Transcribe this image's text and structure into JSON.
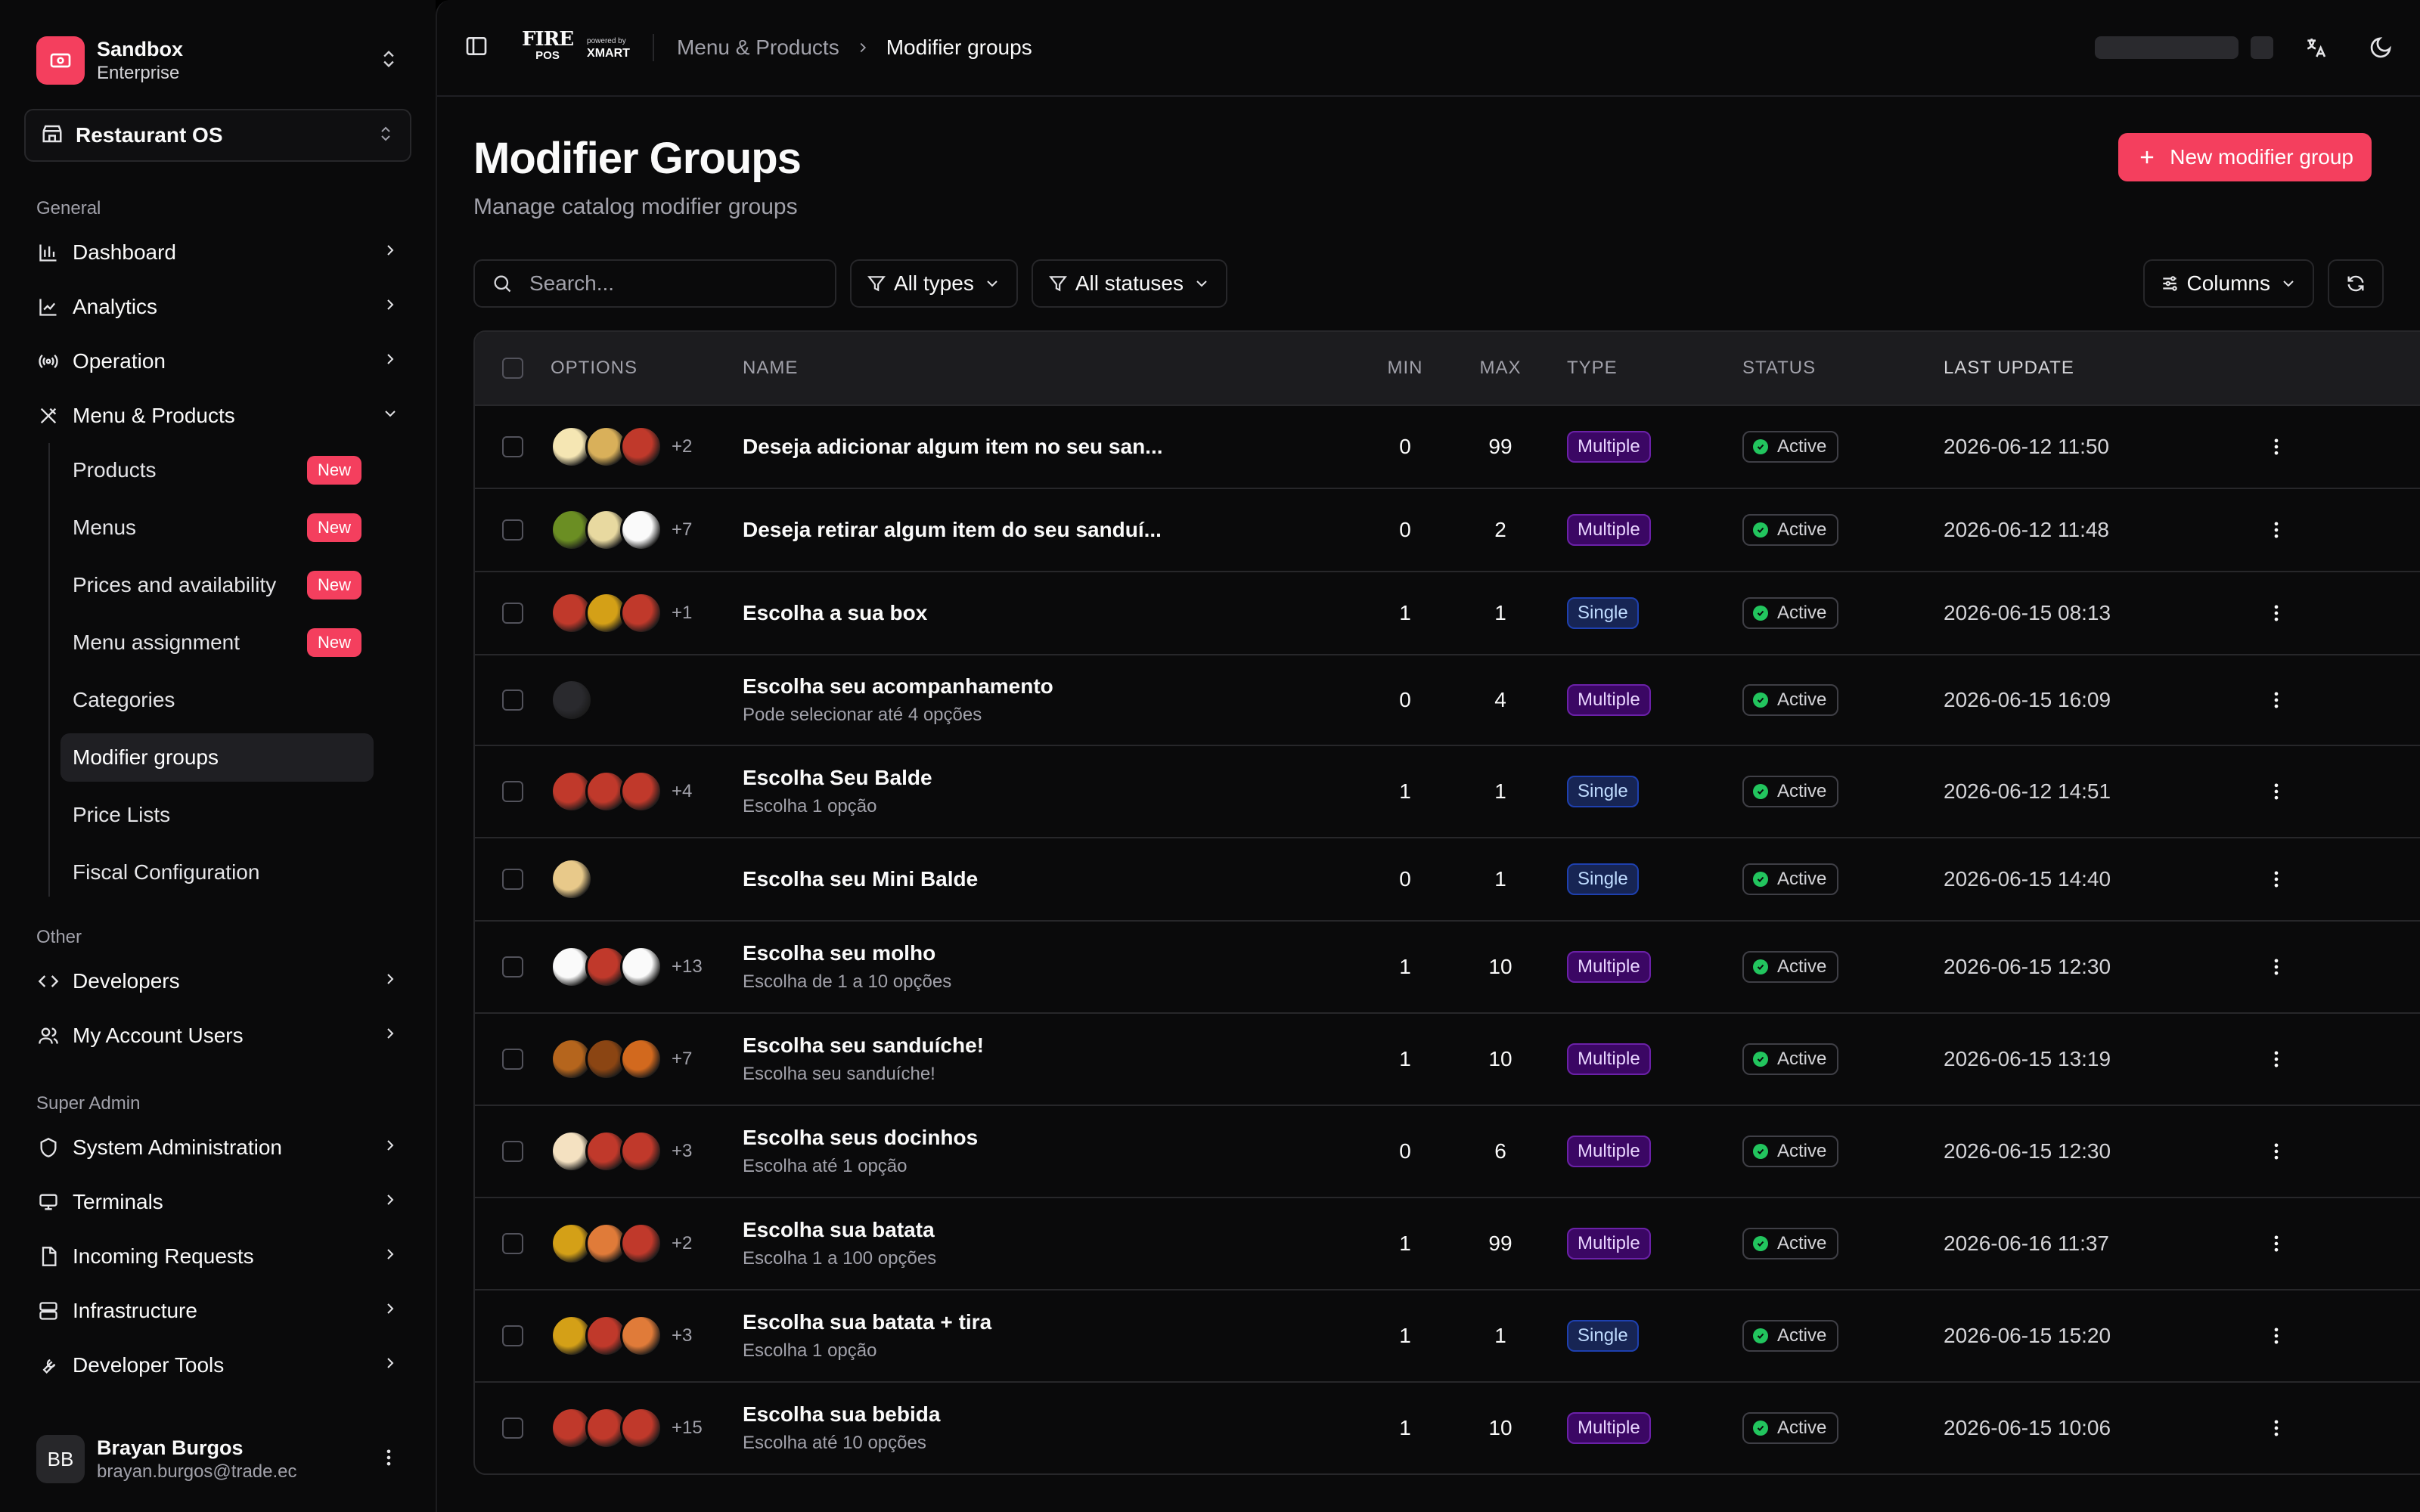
{
  "org": {
    "name": "Sandbox",
    "plan": "Enterprise"
  },
  "store": {
    "label": "Restaurant OS"
  },
  "sections": {
    "general": "General",
    "other": "Other",
    "super_admin": "Super Admin"
  },
  "nav": {
    "dashboard": "Dashboard",
    "analytics": "Analytics",
    "operation": "Operation",
    "menu_products": "Menu & Products",
    "developers": "Developers",
    "my_account_users": "My Account Users",
    "system_administration": "System Administration",
    "terminals": "Terminals",
    "incoming_requests": "Incoming Requests",
    "infrastructure": "Infrastructure",
    "developer_tools": "Developer Tools"
  },
  "sub_nav": [
    {
      "label": "Products",
      "badge": "New"
    },
    {
      "label": "Menus",
      "badge": "New"
    },
    {
      "label": "Prices and availability",
      "badge": "New"
    },
    {
      "label": "Menu assignment",
      "badge": "New"
    },
    {
      "label": "Categories",
      "badge": ""
    },
    {
      "label": "Modifier groups",
      "badge": ""
    },
    {
      "label": "Price Lists",
      "badge": ""
    },
    {
      "label": "Fiscal Configuration",
      "badge": ""
    }
  ],
  "user": {
    "initials": "BB",
    "name": "Brayan Burgos",
    "email": "brayan.burgos@trade.ec"
  },
  "brand": {
    "logo_main": "FIRE",
    "logo_sub": "POS",
    "powered": "powered by",
    "partner": "XMART"
  },
  "breadcrumb": {
    "parent": "Menu & Products",
    "current": "Modifier groups"
  },
  "page": {
    "title": "Modifier Groups",
    "subtitle": "Manage catalog modifier groups",
    "new_button": "New modifier group"
  },
  "toolbar": {
    "search_placeholder": "Search...",
    "type_filter": "All types",
    "status_filter": "All statuses",
    "columns": "Columns"
  },
  "table": {
    "headers": {
      "options": "OPTIONS",
      "name": "NAME",
      "min": "MIN",
      "max": "MAX",
      "type": "TYPE",
      "status": "STATUS",
      "last_update": "LAST UPDATE"
    },
    "rows": [
      {
        "more": "+2",
        "name": "Deseja adicionar algum item no seu san...",
        "desc": "",
        "min": "0",
        "max": "99",
        "type": "Multiple",
        "status": "Active",
        "updated": "2026-06-12 11:50"
      },
      {
        "more": "+7",
        "name": "Deseja retirar algum item do seu sanduí...",
        "desc": "",
        "min": "0",
        "max": "2",
        "type": "Multiple",
        "status": "Active",
        "updated": "2026-06-12 11:48"
      },
      {
        "more": "+1",
        "name": "Escolha a sua box",
        "desc": "",
        "min": "1",
        "max": "1",
        "type": "Single",
        "status": "Active",
        "updated": "2026-06-15 08:13"
      },
      {
        "more": "",
        "name": "Escolha seu acompanhamento",
        "desc": "Pode selecionar até 4 opções",
        "min": "0",
        "max": "4",
        "type": "Multiple",
        "status": "Active",
        "updated": "2026-06-15 16:09"
      },
      {
        "more": "+4",
        "name": "Escolha Seu Balde",
        "desc": "Escolha 1 opção",
        "min": "1",
        "max": "1",
        "type": "Single",
        "status": "Active",
        "updated": "2026-06-12 14:51"
      },
      {
        "more": "",
        "name": "Escolha seu Mini Balde",
        "desc": "",
        "min": "0",
        "max": "1",
        "type": "Single",
        "status": "Active",
        "updated": "2026-06-15 14:40"
      },
      {
        "more": "+13",
        "name": "Escolha seu molho",
        "desc": "Escolha de 1 a 10 opções",
        "min": "1",
        "max": "10",
        "type": "Multiple",
        "status": "Active",
        "updated": "2026-06-15 12:30"
      },
      {
        "more": "+7",
        "name": "Escolha seu sanduíche!",
        "desc": "Escolha seu sanduíche!",
        "min": "1",
        "max": "10",
        "type": "Multiple",
        "status": "Active",
        "updated": "2026-06-15 13:19"
      },
      {
        "more": "+3",
        "name": "Escolha seus docinhos",
        "desc": "Escolha até 1 opção",
        "min": "0",
        "max": "6",
        "type": "Multiple",
        "status": "Active",
        "updated": "2026-06-15 12:30"
      },
      {
        "more": "+2",
        "name": "Escolha sua batata",
        "desc": "Escolha 1 a 100 opções",
        "min": "1",
        "max": "99",
        "type": "Multiple",
        "status": "Active",
        "updated": "2026-06-16 11:37"
      },
      {
        "more": "+3",
        "name": "Escolha sua batata + tira",
        "desc": "Escolha 1 opção",
        "min": "1",
        "max": "1",
        "type": "Single",
        "status": "Active",
        "updated": "2026-06-15 15:20"
      },
      {
        "more": "+15",
        "name": "Escolha sua bebida",
        "desc": "Escolha até 10 opções",
        "min": "1",
        "max": "10",
        "type": "Multiple",
        "status": "Active",
        "updated": "2026-06-15 10:06"
      }
    ]
  }
}
